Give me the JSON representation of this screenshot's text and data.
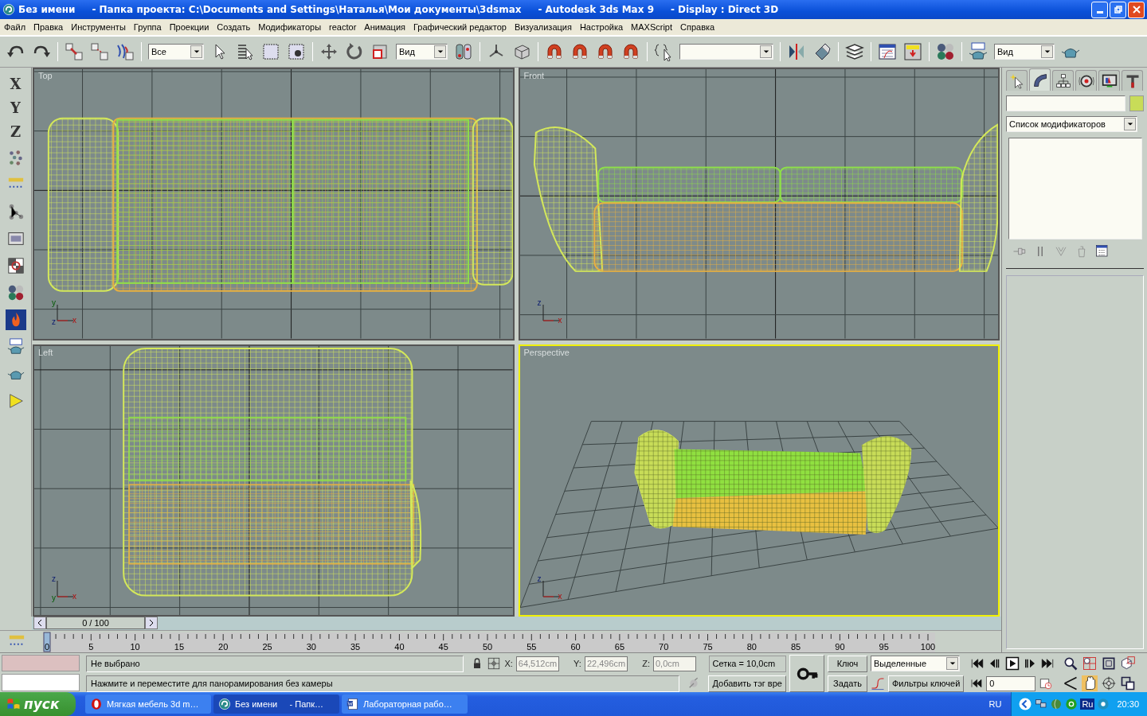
{
  "window": {
    "title": "Без имени     - Папка проекта: C:\\Documents and Settings\\Наталья\\Мои документы\\3dsmax     - Autodesk 3ds Max 9     - Display : Direct 3D"
  },
  "menu": [
    "Файл",
    "Правка",
    "Инструменты",
    "Группа",
    "Проекции",
    "Создать",
    "Модификаторы",
    "reactor",
    "Анимация",
    "Графический редактор",
    "Визуализация",
    "Настройка",
    "MAXScript",
    "Справка"
  ],
  "toolbar": {
    "selection_filter": "Все",
    "reference_coordinate": "Вид",
    "render_type": "Вид"
  },
  "left_toolbar": {
    "axis_buttons": [
      "X",
      "Y",
      "Z"
    ],
    "tools": [
      {
        "kind": "particles",
        "selected": false
      },
      {
        "kind": "dotted",
        "selected": false
      },
      {
        "kind": "nodes",
        "selected": false
      },
      {
        "kind": "film",
        "selected": false
      },
      {
        "kind": "checker",
        "selected": false
      },
      {
        "kind": "spheres",
        "selected": false
      },
      {
        "kind": "flame",
        "selected": true
      },
      {
        "kind": "teapot-window",
        "selected": false
      },
      {
        "kind": "teapot",
        "selected": false
      },
      {
        "kind": "play",
        "selected": false
      }
    ]
  },
  "viewports": [
    {
      "label": "Top",
      "kind": "top",
      "selected": false,
      "axis_labels": [
        "y",
        "z",
        "x"
      ]
    },
    {
      "label": "Front",
      "kind": "front",
      "selected": false,
      "axis_labels": [
        "z",
        "x"
      ]
    },
    {
      "label": "Left",
      "kind": "left",
      "selected": false,
      "axis_labels": [
        "z",
        "y",
        "x"
      ]
    },
    {
      "label": "Perspective",
      "kind": "perspective",
      "selected": true,
      "axis_labels": [
        "z",
        "x"
      ]
    }
  ],
  "command_panel": {
    "tabs": [
      {
        "kind": "create",
        "selected": false
      },
      {
        "kind": "modify",
        "selected": true
      },
      {
        "kind": "hierarchy",
        "selected": false
      },
      {
        "kind": "motion",
        "selected": false
      },
      {
        "kind": "display",
        "selected": false
      },
      {
        "kind": "utilities",
        "selected": false
      }
    ],
    "modifier_list": "Список модификаторов"
  },
  "time_slider": {
    "label": "0 / 100",
    "level": 0
  },
  "track_bar": {
    "labels": [
      "0",
      "5",
      "10",
      "15",
      "20",
      "25",
      "30",
      "35",
      "40",
      "45",
      "50",
      "55",
      "60",
      "65",
      "70",
      "75",
      "80",
      "85",
      "90",
      "95",
      "100"
    ]
  },
  "status_bar": {
    "selection_info": "Не выбрано",
    "prompt": "Нажмите и переместите для панорамирования без камеры",
    "coords": [
      {
        "axis": "X:",
        "value": "64,512cm"
      },
      {
        "axis": "Y:",
        "value": "22,496cm"
      },
      {
        "axis": "Z:",
        "value": "0,0cm"
      }
    ],
    "grid": "Сетка = 10,0cm",
    "add_time_tag": "Добавить тэг вре"
  },
  "animation": {
    "key_mode_button": "Ключ",
    "set_key_button": "Задать",
    "key_filter": "Выделенные",
    "key_filters_button": "Фильтры ключей",
    "current_frame": "0"
  },
  "taskbar": {
    "start": "пуск",
    "tasks": [
      {
        "label": "Мягкая мебель 3d m…",
        "kind": "browser",
        "selected": false
      },
      {
        "label": "Без имени     - Папк…",
        "kind": "max",
        "selected": true
      },
      {
        "label": "Лабораторная рабо…",
        "kind": "document",
        "selected": false
      }
    ],
    "language": "RU",
    "tray_language": "Ru",
    "clock": "20:30"
  }
}
